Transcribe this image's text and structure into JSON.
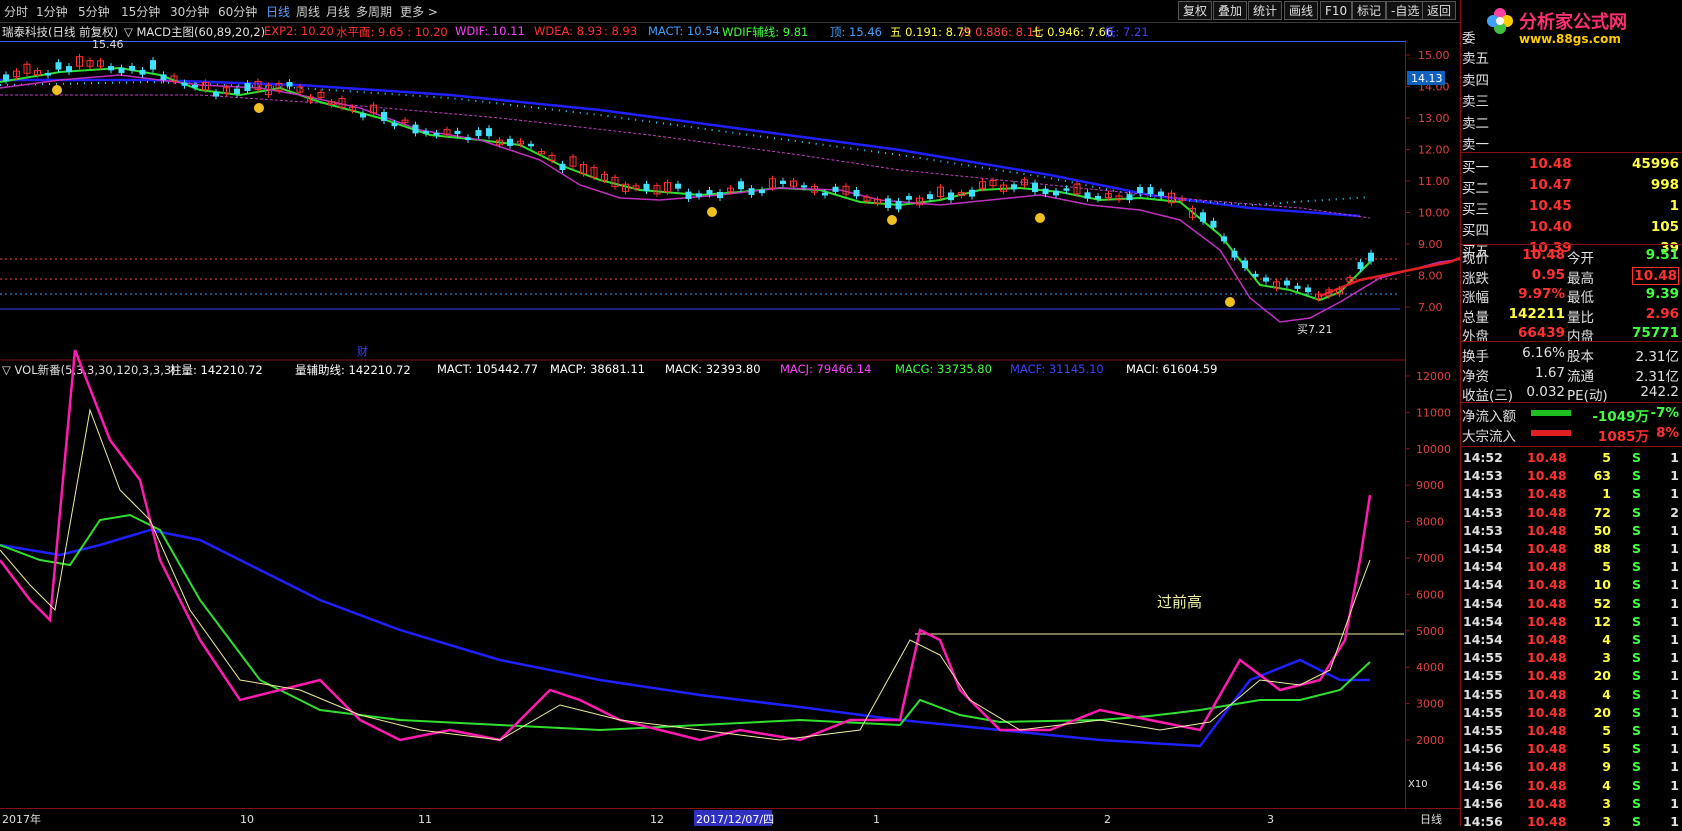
{
  "toolbar": {
    "periods": [
      "分时",
      "1分钟",
      "5分钟",
      "15分钟",
      "30分钟",
      "60分钟",
      "日线",
      "周线",
      "月线",
      "多周期",
      "更多 >"
    ],
    "active_period": "日线",
    "buttons": [
      "复权",
      "叠加",
      "统计",
      "画线",
      "F10",
      "标记",
      "-自选",
      "返回"
    ]
  },
  "logo": {
    "title": "分析家公式网",
    "url": "www.88gs.com"
  },
  "main_indicator": {
    "stock": "瑞泰科技(日线 前复权)",
    "name": "▽ MACD主图(60,89,20,2)",
    "items": [
      {
        "text": "EXP2: 10.20",
        "color": "#ff3030"
      },
      {
        "text": "水平面: 9.65 : 10.20",
        "color": "#ff3030"
      },
      {
        "text": "WDIF: 10.11",
        "color": "#ff40ff"
      },
      {
        "text": "WDEA: 8.93",
        "color": "#ff3030"
      },
      {
        "text": ": 8.93",
        "color": "#ff3030"
      },
      {
        "text": "MACT: 10.54",
        "color": "#40a0ff"
      },
      {
        "text": "WDIF辅线: 9.81",
        "color": "#40ff40"
      },
      {
        "text": "顶: 15.46",
        "color": "#40a0ff"
      },
      {
        "text": "五 0.191: 8.79",
        "color": "#ffff40"
      },
      {
        "text": "六 0.886: 8.15",
        "color": "#ff4040"
      },
      {
        "text": "七 0.946: 7.66",
        "color": "#ffff40"
      },
      {
        "text": "低: 7.21",
        "color": "#4040ff"
      }
    ],
    "price_axis": [
      "15.00",
      "14.00",
      "13.00",
      "12.00",
      "11.00",
      "10.00",
      "9.00",
      "8.00",
      "7.00"
    ],
    "current_price_label": "14.13",
    "high_label": "15.46",
    "low_label": "买7.21",
    "fin_label": "财"
  },
  "vol_indicator": {
    "name": "▽ VOL新番(5,3,3,30,120,3,3,3)",
    "items": [
      {
        "text": "柱量: 142210.72",
        "color": "#ffffff"
      },
      {
        "text": "量辅助线: 142210.72",
        "color": "#ffffff"
      },
      {
        "text": "MACT: 105442.77",
        "color": "#ffffff"
      },
      {
        "text": "MACP: 38681.11",
        "color": "#ffffff"
      },
      {
        "text": "MACK: 32393.80",
        "color": "#ffffff"
      },
      {
        "text": "MACJ: 79466.14",
        "color": "#ff40ff"
      },
      {
        "text": "MACG: 33735.80",
        "color": "#40ff40"
      },
      {
        "text": "MACF: 31145.10",
        "color": "#4040ff"
      },
      {
        "text": "MACI: 61604.59",
        "color": "#ffffff"
      }
    ],
    "axis": [
      "12000",
      "11000",
      "10000",
      "9000",
      "8000",
      "7000",
      "6000",
      "5000",
      "4000",
      "3000",
      "2000"
    ],
    "unit": "X10",
    "annotation": "过前高"
  },
  "time_axis": {
    "labels": [
      "2017年",
      "10",
      "11",
      "12",
      "2017/12/07/四",
      "1",
      "2",
      "3"
    ],
    "period_label": "日线"
  },
  "quote_panel": {
    "wei": "委",
    "sells": [
      {
        "label": "卖五",
        "price": "",
        "vol": ""
      },
      {
        "label": "卖四",
        "price": "",
        "vol": ""
      },
      {
        "label": "卖三",
        "price": "",
        "vol": ""
      },
      {
        "label": "卖二",
        "price": "",
        "vol": ""
      },
      {
        "label": "卖一",
        "price": "",
        "vol": ""
      }
    ],
    "buys": [
      {
        "label": "买一",
        "price": "10.48",
        "vol": "45996"
      },
      {
        "label": "买二",
        "price": "10.47",
        "vol": "998"
      },
      {
        "label": "买三",
        "price": "10.45",
        "vol": "1"
      },
      {
        "label": "买四",
        "price": "10.40",
        "vol": "105"
      },
      {
        "label": "买五",
        "price": "10.39",
        "vol": "39"
      }
    ],
    "stats": [
      {
        "l1": "现价",
        "v1": "10.48",
        "c1": "#ff3030",
        "l2": "今开",
        "v2": "9.51",
        "c2": "#40ff40"
      },
      {
        "l1": "涨跌",
        "v1": "0.95",
        "c1": "#ff3030",
        "l2": "最高",
        "v2": "10.48",
        "c2": "#ff3030"
      },
      {
        "l1": "涨幅",
        "v1": "9.97%",
        "c1": "#ff3030",
        "l2": "最低",
        "v2": "9.39",
        "c2": "#40ff40"
      },
      {
        "l1": "总量",
        "v1": "142211",
        "c1": "#ffff40",
        "l2": "量比",
        "v2": "2.96",
        "c2": "#ff3030"
      },
      {
        "l1": "外盘",
        "v1": "66439",
        "c1": "#ff3030",
        "l2": "内盘",
        "v2": "75771",
        "c2": "#40ff40"
      }
    ],
    "stats2": [
      {
        "l1": "换手",
        "v1": "6.16%",
        "c1": "#e0e0e0",
        "l2": "股本",
        "v2": "2.31亿",
        "c2": "#e0e0e0"
      },
      {
        "l1": "净资",
        "v1": "1.67",
        "c1": "#e0e0e0",
        "l2": "流通",
        "v2": "2.31亿",
        "c2": "#e0e0e0"
      },
      {
        "l1": "收益(三)",
        "v1": "0.032",
        "c1": "#e0e0e0",
        "l2": "PE(动)",
        "v2": "242.2",
        "c2": "#e0e0e0"
      }
    ],
    "flows": [
      {
        "label": "净流入额",
        "bar_color": "#20c020",
        "value": "-1049万",
        "pct": "-7%",
        "color": "#40ff40"
      },
      {
        "label": "大宗流入",
        "bar_color": "#e02020",
        "value": "1085万",
        "pct": "8%",
        "color": "#ff3030"
      }
    ],
    "ticks": [
      {
        "t": "14:52",
        "p": "10.48",
        "v": "5",
        "s": "S",
        "n": "1"
      },
      {
        "t": "14:53",
        "p": "10.48",
        "v": "63",
        "s": "S",
        "n": "1"
      },
      {
        "t": "14:53",
        "p": "10.48",
        "v": "1",
        "s": "S",
        "n": "1"
      },
      {
        "t": "14:53",
        "p": "10.48",
        "v": "72",
        "s": "S",
        "n": "2"
      },
      {
        "t": "14:53",
        "p": "10.48",
        "v": "50",
        "s": "S",
        "n": "1"
      },
      {
        "t": "14:54",
        "p": "10.48",
        "v": "88",
        "s": "S",
        "n": "1"
      },
      {
        "t": "14:54",
        "p": "10.48",
        "v": "5",
        "s": "S",
        "n": "1"
      },
      {
        "t": "14:54",
        "p": "10.48",
        "v": "10",
        "s": "S",
        "n": "1"
      },
      {
        "t": "14:54",
        "p": "10.48",
        "v": "52",
        "s": "S",
        "n": "1"
      },
      {
        "t": "14:54",
        "p": "10.48",
        "v": "12",
        "s": "S",
        "n": "1"
      },
      {
        "t": "14:54",
        "p": "10.48",
        "v": "4",
        "s": "S",
        "n": "1"
      },
      {
        "t": "14:55",
        "p": "10.48",
        "v": "3",
        "s": "S",
        "n": "1"
      },
      {
        "t": "14:55",
        "p": "10.48",
        "v": "20",
        "s": "S",
        "n": "1"
      },
      {
        "t": "14:55",
        "p": "10.48",
        "v": "4",
        "s": "S",
        "n": "1"
      },
      {
        "t": "14:55",
        "p": "10.48",
        "v": "20",
        "s": "S",
        "n": "1"
      },
      {
        "t": "14:55",
        "p": "10.48",
        "v": "5",
        "s": "S",
        "n": "1"
      },
      {
        "t": "14:56",
        "p": "10.48",
        "v": "5",
        "s": "S",
        "n": "1"
      },
      {
        "t": "14:56",
        "p": "10.48",
        "v": "9",
        "s": "S",
        "n": "1"
      },
      {
        "t": "14:56",
        "p": "10.48",
        "v": "4",
        "s": "S",
        "n": "1"
      },
      {
        "t": "14:56",
        "p": "10.48",
        "v": "3",
        "s": "S",
        "n": "1"
      },
      {
        "t": "14:56",
        "p": "10.48",
        "v": "3",
        "s": "S",
        "n": "1"
      }
    ]
  }
}
